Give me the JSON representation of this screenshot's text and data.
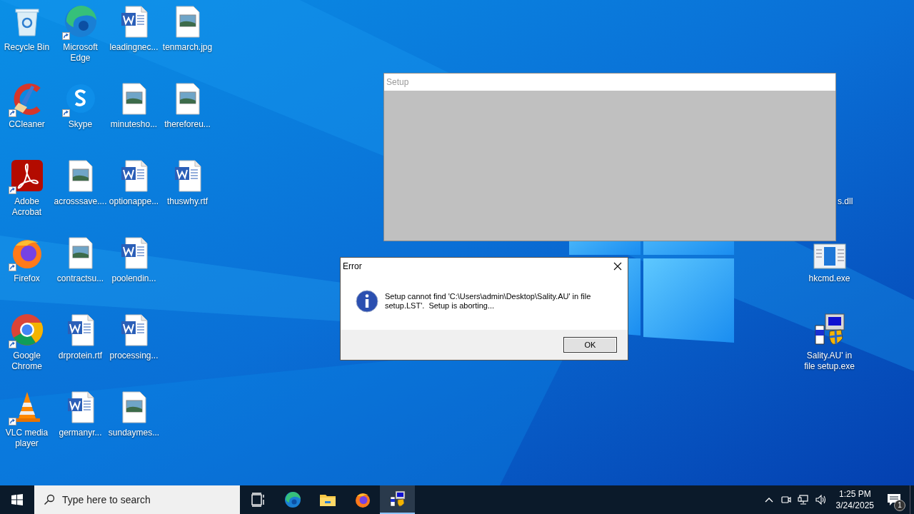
{
  "desktop": {
    "icons": [
      {
        "label": "Recycle Bin",
        "kind": "recycle",
        "shortcut": false
      },
      {
        "label": "CCleaner",
        "kind": "ccleaner",
        "shortcut": true
      },
      {
        "label": "Adobe Acrobat",
        "kind": "acrobat",
        "shortcut": true
      },
      {
        "label": "Firefox",
        "kind": "firefox",
        "shortcut": true
      },
      {
        "label": "Google Chrome",
        "kind": "chrome",
        "shortcut": true
      },
      {
        "label": "VLC media player",
        "kind": "vlc",
        "shortcut": true
      },
      {
        "label": "Microsoft Edge",
        "kind": "edge",
        "shortcut": true
      },
      {
        "label": "Skype",
        "kind": "skype",
        "shortcut": true
      },
      {
        "label": "acrosssave....",
        "shortcut": false
      },
      {
        "label": "contractsu...",
        "shortcut": false
      },
      {
        "label": "drprotein.rtf",
        "kind": "word",
        "shortcut": false
      },
      {
        "label": "germanyr...",
        "kind": "word",
        "shortcut": false
      },
      {
        "label": "leadingnec...",
        "kind": "word",
        "shortcut": false
      },
      {
        "label": "minutesho...",
        "shortcut": false
      },
      {
        "label": "optionappe...",
        "kind": "word",
        "shortcut": false
      },
      {
        "label": "poolendin...",
        "kind": "word",
        "shortcut": false
      },
      {
        "label": "processing...",
        "kind": "word",
        "shortcut": false
      },
      {
        "label": "sundaymes...",
        "shortcut": false
      },
      {
        "label": "tenmarch.jpg",
        "shortcut": false
      },
      {
        "label": "thereforeu...",
        "shortcut": false
      },
      {
        "label": "thuswhy.rtf",
        "kind": "word",
        "shortcut": false
      }
    ],
    "right_icons": [
      {
        "label": "s.dll",
        "kind": "hidden"
      },
      {
        "label": "hkcmd.exe",
        "kind": "app"
      },
      {
        "label": "Sality.AU' in file setup.exe",
        "kind": "installer"
      }
    ]
  },
  "setup_window": {
    "title": "Setup"
  },
  "error_dialog": {
    "title": "Error",
    "message": "Setup cannot find 'C:\\Users\\admin\\Desktop\\Sality.AU' in file setup.LST'.  Setup is aborting...",
    "button": "OK"
  },
  "taskbar": {
    "search": {
      "placeholder": "Type here to search"
    },
    "apps": [
      {
        "kind": "taskview",
        "active": false
      },
      {
        "kind": "edge",
        "active": false
      },
      {
        "kind": "explorer",
        "active": false
      },
      {
        "kind": "firefox",
        "active": false
      },
      {
        "kind": "setup",
        "active": true
      }
    ],
    "clock": {
      "time": "1:25 PM",
      "date": "3/24/2025"
    },
    "notifications": {
      "count": "1"
    }
  }
}
